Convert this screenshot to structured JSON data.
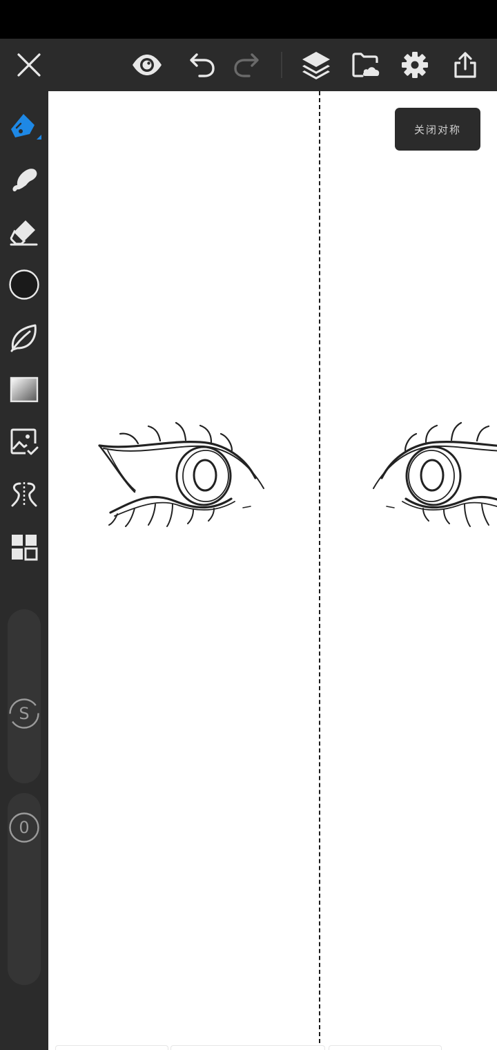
{
  "app": {
    "toolbar": {
      "close": {
        "icon": "close-icon"
      },
      "visibility": {
        "icon": "eye-icon"
      },
      "undo": {
        "icon": "undo-icon"
      },
      "redo": {
        "icon": "redo-icon",
        "enabled": false
      },
      "layers": {
        "icon": "layers-icon"
      },
      "import": {
        "icon": "folder-cloud-icon"
      },
      "settings": {
        "icon": "gear-icon"
      },
      "export": {
        "icon": "share-icon"
      }
    },
    "sidebar": {
      "tools": [
        {
          "name": "pen",
          "icon": "pen-icon",
          "active": true
        },
        {
          "name": "smudge",
          "icon": "smudge-icon"
        },
        {
          "name": "eraser",
          "icon": "eraser-icon"
        },
        {
          "name": "color",
          "icon": "color-swatch-icon",
          "color": "#1a1a1a"
        },
        {
          "name": "fill",
          "icon": "leaf-icon"
        },
        {
          "name": "gradient",
          "icon": "gradient-icon"
        },
        {
          "name": "image",
          "icon": "image-icon"
        },
        {
          "name": "symmetry",
          "icon": "symmetry-icon"
        },
        {
          "name": "more",
          "icon": "grid-icon"
        }
      ],
      "size_slider": {
        "label": "S"
      },
      "opacity_slider": {
        "label": "0"
      }
    },
    "toast": {
      "text": "关闭对称"
    },
    "colors": {
      "accent": "#1e88e5",
      "toolbar_bg": "#2b2b2b",
      "canvas_bg": "#ffffff"
    }
  }
}
